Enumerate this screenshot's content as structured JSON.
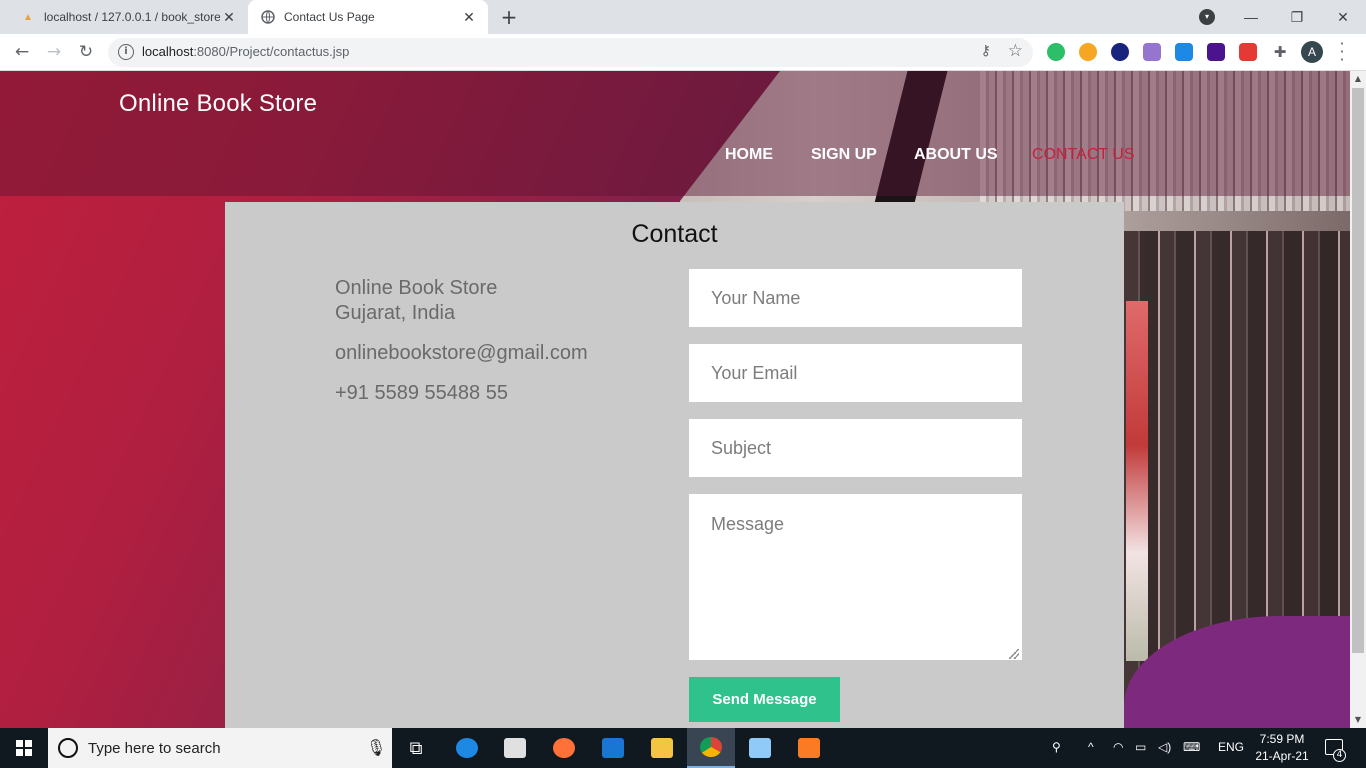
{
  "browser": {
    "tabs": [
      {
        "title": "localhost / 127.0.0.1 / book_store",
        "favicon": "phpmyadmin-icon",
        "active": false
      },
      {
        "title": "Contact Us Page",
        "favicon": "globe-icon",
        "active": true
      }
    ],
    "url": "localhost:8080/Project/contactus.jsp",
    "url_host": "localhost",
    "url_rest": ":8080/Project/contactus.jsp",
    "extension_badge": "8",
    "profile_initial": "A"
  },
  "page": {
    "brand": "Online Book Store",
    "nav": [
      "HOME",
      "SIGN UP",
      "ABOUT US",
      "CONTACT US"
    ],
    "current_nav": "CONTACT US",
    "contact": {
      "title": "Contact",
      "address_line1": "Online Book Store",
      "address_line2": "Gujarat, India",
      "email": "onlinebookstore@gmail.com",
      "phone": "+91 5589 55488 55",
      "form": {
        "name_placeholder": "Your Name",
        "email_placeholder": "Your Email",
        "subject_placeholder": "Subject",
        "message_placeholder": "Message",
        "submit_label": "Send Message"
      }
    },
    "colors": {
      "accent_button": "#2fc28d",
      "active_nav": "#c5213d",
      "card_bg": "#cacaca"
    }
  },
  "taskbar": {
    "search_placeholder": "Type here to search",
    "language": "ENG",
    "time": "7:59 PM",
    "date": "21-Apr-21",
    "notification_count": "4"
  }
}
